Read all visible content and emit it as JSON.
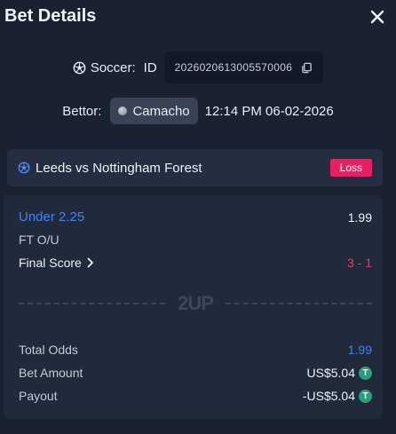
{
  "header": {
    "title": "Bet Details",
    "close_icon": "close-icon"
  },
  "bet": {
    "sport_label": "Soccer:",
    "id_label": "ID",
    "bet_id": "2026020613005570006",
    "copy_icon": "copy-icon"
  },
  "bettor": {
    "label": "Bettor:",
    "username": "Camacho",
    "datetime": "12:14 PM 06-02-2026"
  },
  "match": {
    "name": "Leeds vs Nottingham Forest",
    "status": "Loss",
    "status_color": "#e91e63"
  },
  "selection": {
    "pick": "Under 2.25",
    "odds": "1.99",
    "market": "FT O/U",
    "final_score_label": "Final Score",
    "final_score": "3 - 1"
  },
  "brand": {
    "logo_text": "2UP"
  },
  "summary": {
    "total_odds_label": "Total Odds",
    "total_odds": "1.99",
    "bet_amount_label": "Bet Amount",
    "bet_amount": "US$5.04",
    "payout_label": "Payout",
    "payout": "-US$5.04",
    "currency_icon": "tether-icon"
  },
  "colors": {
    "background": "#1a2232",
    "accent_blue": "#3f82ff",
    "loss_red": "#e91e63",
    "tether_green": "#26a17b"
  }
}
